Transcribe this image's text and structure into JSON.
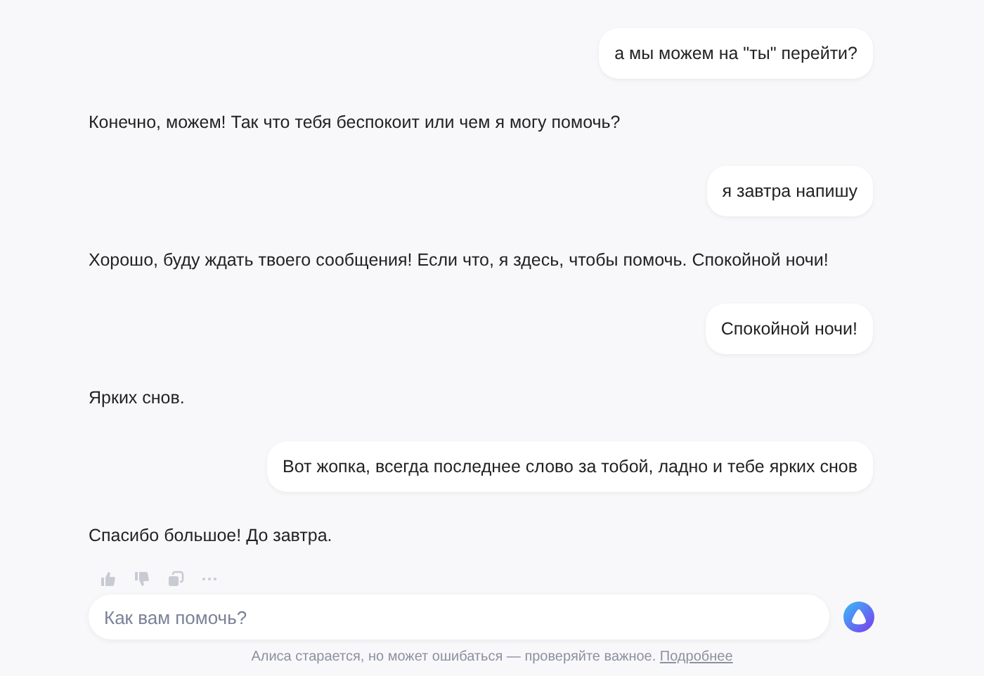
{
  "messages": [
    {
      "kind": "user",
      "text": "а мы можем на \"ты\" перейти?"
    },
    {
      "kind": "assistant",
      "text": "Конечно, можем! Так что тебя беспокоит или чем я могу помочь?"
    },
    {
      "kind": "user",
      "text": "я завтра напишу"
    },
    {
      "kind": "assistant",
      "text": "Хорошо, буду ждать твоего сообщения! Если что, я здесь, чтобы помочь. Спокойной ночи!"
    },
    {
      "kind": "user",
      "text": "Спокойной ночи!"
    },
    {
      "kind": "assistant",
      "text": "Ярких снов."
    },
    {
      "kind": "user",
      "text": "Вот жопка, всегда последнее слово за тобой, ладно и тебе ярких снов"
    },
    {
      "kind": "assistant",
      "text": "Спасибо большое! До завтра."
    }
  ],
  "input": {
    "placeholder": "Как вам помочь?"
  },
  "disclaimer": {
    "text": "Алиса старается, но может ошибаться — проверяйте важное.",
    "link": "Подробнее"
  }
}
